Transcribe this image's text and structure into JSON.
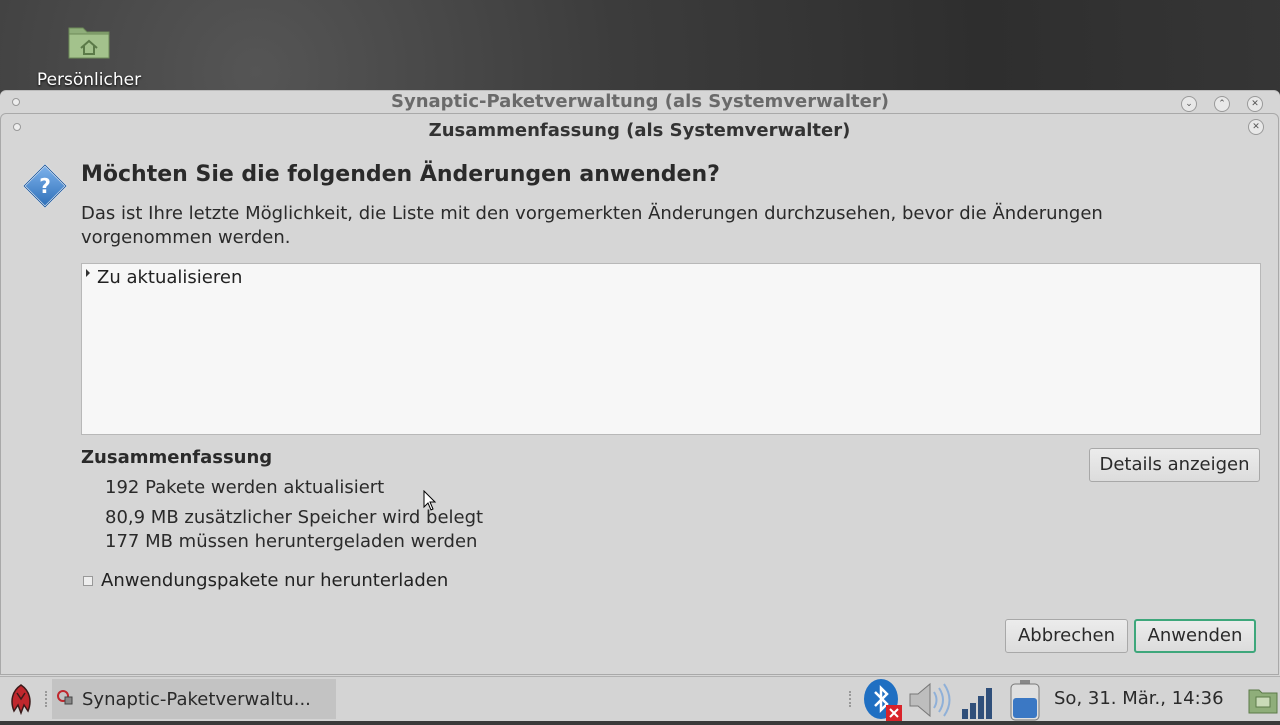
{
  "desktop": {
    "icon_label": "Persönlicher"
  },
  "main_window": {
    "title": "Synaptic-Paketverwaltung  (als Systemverwalter)"
  },
  "dialog": {
    "title": "Zusammenfassung (als Systemverwalter)",
    "headline": "Möchten Sie die folgenden Änderungen anwenden?",
    "description": "Das ist Ihre letzte Möglichkeit, die Liste mit den vorgemerkten Änderungen durchzusehen, bevor die Änderungen vorgenommen werden.",
    "tree": {
      "items": [
        {
          "label": "Zu aktualisieren"
        }
      ]
    },
    "summary": {
      "heading": "Zusammenfassung",
      "lines": [
        "192 Pakete werden aktualisiert",
        "80,9 MB zusätzlicher Speicher wird belegt",
        "177 MB müssen heruntergeladen werden"
      ]
    },
    "details_button": "Details anzeigen",
    "download_only_label": "Anwendungspakete nur herunterladen",
    "download_only_checked": false,
    "cancel_button": "Abbrechen",
    "apply_button": "Anwenden"
  },
  "taskbar": {
    "task_label": "Synaptic-Paketverwaltu...",
    "clock": "So, 31. Mär., 14:36",
    "tray_icons": [
      "bluetooth-icon",
      "volume-icon",
      "network-signal-icon",
      "battery-icon",
      "show-desktop-icon"
    ]
  },
  "colors": {
    "default_button_border": "#3ea77b",
    "dialog_bg": "#d6d6d6",
    "bluetooth_blue": "#1f6fc2"
  }
}
